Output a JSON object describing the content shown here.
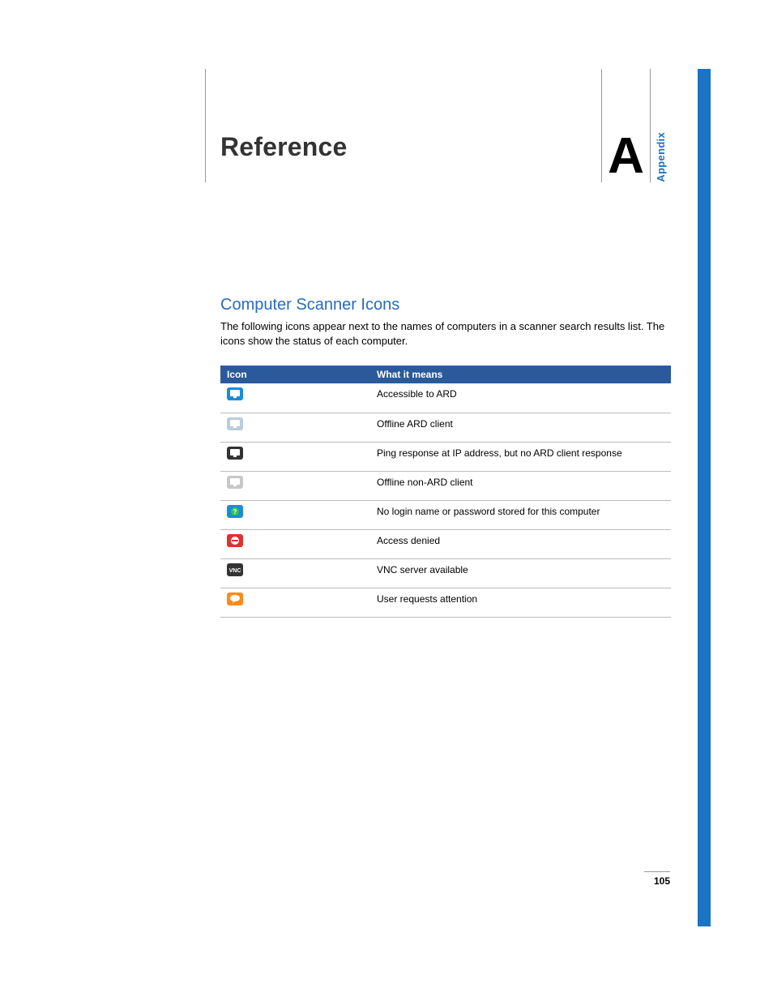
{
  "page": {
    "title": "Reference",
    "appendix_letter": "A",
    "appendix_label": "Appendix",
    "number": "105"
  },
  "section": {
    "heading": "Computer Scanner Icons",
    "intro": "The following icons appear next to the names of computers in a scanner search results list. The icons show the status of each computer."
  },
  "table": {
    "head_icon": "Icon",
    "head_meaning": "What it means",
    "rows": [
      {
        "icon_name": "ard-accessible-icon",
        "meaning": "Accessible to ARD"
      },
      {
        "icon_name": "ard-offline-icon",
        "meaning": "Offline ARD client"
      },
      {
        "icon_name": "ping-no-ard-icon",
        "meaning": "Ping response at IP address, but no ARD client response"
      },
      {
        "icon_name": "offline-non-ard-icon",
        "meaning": "Offline non-ARD client"
      },
      {
        "icon_name": "no-credentials-icon",
        "meaning": "No login name or password stored for this computer"
      },
      {
        "icon_name": "access-denied-icon",
        "meaning": "Access denied"
      },
      {
        "icon_name": "vnc-available-icon",
        "meaning": "VNC server available"
      },
      {
        "icon_name": "attention-icon",
        "meaning": "User requests attention"
      }
    ]
  }
}
